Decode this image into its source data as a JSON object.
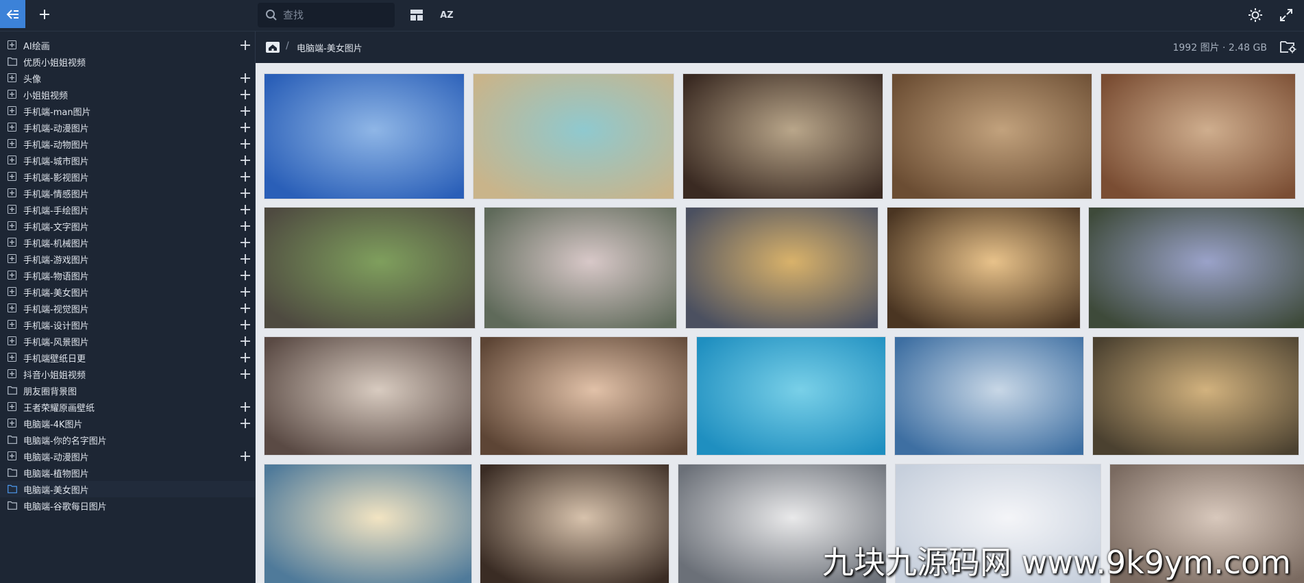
{
  "search": {
    "placeholder": "查找"
  },
  "toolbar": {
    "sort_label": "AZ"
  },
  "sidebar": {
    "items": [
      {
        "label": "AI绘画",
        "expand": true,
        "add": true
      },
      {
        "label": "优质小姐姐视频",
        "expand": false,
        "add": false
      },
      {
        "label": "头像",
        "expand": true,
        "add": true
      },
      {
        "label": "小姐姐视频",
        "expand": true,
        "add": true
      },
      {
        "label": "手机端-man图片",
        "expand": true,
        "add": true
      },
      {
        "label": "手机端-动漫图片",
        "expand": true,
        "add": true
      },
      {
        "label": "手机端-动物图片",
        "expand": true,
        "add": true
      },
      {
        "label": "手机端-城市图片",
        "expand": true,
        "add": true
      },
      {
        "label": "手机端-影视图片",
        "expand": true,
        "add": true
      },
      {
        "label": "手机端-情感图片",
        "expand": true,
        "add": true
      },
      {
        "label": "手机端-手绘图片",
        "expand": true,
        "add": true
      },
      {
        "label": "手机端-文字图片",
        "expand": true,
        "add": true
      },
      {
        "label": "手机端-机械图片",
        "expand": true,
        "add": true
      },
      {
        "label": "手机端-游戏图片",
        "expand": true,
        "add": true
      },
      {
        "label": "手机端-物语图片",
        "expand": true,
        "add": true
      },
      {
        "label": "手机端-美女图片",
        "expand": true,
        "add": true
      },
      {
        "label": "手机端-视觉图片",
        "expand": true,
        "add": true
      },
      {
        "label": "手机端-设计图片",
        "expand": true,
        "add": true
      },
      {
        "label": "手机端-风景图片",
        "expand": true,
        "add": true
      },
      {
        "label": "手机端壁纸日更",
        "expand": true,
        "add": true
      },
      {
        "label": "抖音小姐姐视频",
        "expand": true,
        "add": true
      },
      {
        "label": "朋友圈背景图",
        "expand": false,
        "add": false
      },
      {
        "label": "王者荣耀原画壁纸",
        "expand": true,
        "add": true
      },
      {
        "label": "电脑端-4K图片",
        "expand": true,
        "add": true
      },
      {
        "label": "电脑端-你的名字图片",
        "expand": false,
        "add": false
      },
      {
        "label": "电脑端-动漫图片",
        "expand": true,
        "add": true
      },
      {
        "label": "电脑端-植物图片",
        "expand": false,
        "add": false
      },
      {
        "label": "电脑端-美女图片",
        "expand": false,
        "add": false,
        "active": true
      },
      {
        "label": "电脑端-谷歌每日图片",
        "expand": false,
        "add": false
      }
    ]
  },
  "breadcrumb": {
    "separator": "/",
    "current": "电脑端-美女图片"
  },
  "stats": {
    "text": "1992 图片 · 2.48 GB"
  },
  "colors": {
    "accent": "#3c82d8",
    "bg": "#1d2634",
    "gallery_bg": "#e6e9ee"
  },
  "gallery": {
    "rows": [
      [
        {
          "c1": "#2a5fb8",
          "c2": "#8fb6e6"
        },
        {
          "c1": "#c9b48a",
          "c2": "#8fc9cf"
        },
        {
          "c1": "#3a2a22",
          "c2": "#b9a68a"
        },
        {
          "c1": "#6b4d33",
          "c2": "#c2a27d"
        },
        {
          "c1": "#7a4d33",
          "c2": "#cfae8e"
        }
      ],
      [
        {
          "c1": "#4e4a40",
          "c2": "#7f9f5d"
        },
        {
          "c1": "#5f6a5a",
          "c2": "#d8c8c8"
        },
        {
          "c1": "#4b5060",
          "c2": "#d9b26a"
        },
        {
          "c1": "#4a3522",
          "c2": "#e8c28a"
        },
        {
          "c1": "#3e4a3a",
          "c2": "#9aa2c9"
        }
      ],
      [
        {
          "c1": "#5a4a44",
          "c2": "#d8cbc0"
        },
        {
          "c1": "#5d4535",
          "c2": "#e1c1a8"
        },
        {
          "c1": "#1f8fc0",
          "c2": "#79d0e8"
        },
        {
          "c1": "#3e6fa2",
          "c2": "#c8d7e6"
        },
        {
          "c1": "#4b4130",
          "c2": "#d2b27e"
        }
      ],
      [
        {
          "c1": "#4f7a9a",
          "c2": "#f2e4c2"
        },
        {
          "c1": "#3a2c24",
          "c2": "#d7c2ac"
        },
        {
          "c1": "#6b7078",
          "c2": "#e9e9ea"
        },
        {
          "c1": "#c6cfdc",
          "c2": "#f4f5f8"
        },
        {
          "c1": "#7a6a60",
          "c2": "#d8c8bc"
        }
      ]
    ]
  },
  "watermark": {
    "text": "九块九源码网 www.9k9ym.com"
  }
}
